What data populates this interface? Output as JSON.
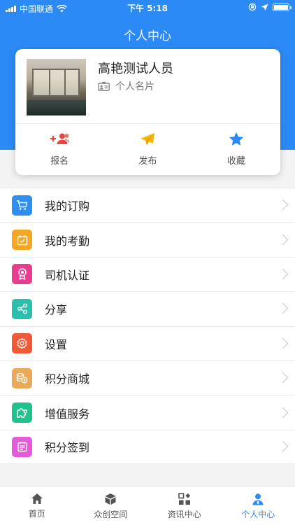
{
  "status_bar": {
    "carrier": "中国联通",
    "time": "下午 5:18"
  },
  "header": {
    "title": "个人中心"
  },
  "profile": {
    "name": "高艳测试人员",
    "card_label": "个人名片"
  },
  "actions": [
    {
      "label": "报名",
      "icon": "add-users-icon",
      "color": "#e8463d"
    },
    {
      "label": "发布",
      "icon": "paper-plane-icon",
      "color": "#f5b800"
    },
    {
      "label": "收藏",
      "icon": "star-icon",
      "color": "#2b8af5"
    }
  ],
  "menu": [
    {
      "label": "我的订购",
      "icon": "cart-icon",
      "color": "#2e8ff0"
    },
    {
      "label": "我的考勤",
      "icon": "calendar-icon",
      "color": "#f5a623"
    },
    {
      "label": "司机认证",
      "icon": "badge-icon",
      "color": "#ea3d8f"
    },
    {
      "label": "分享",
      "icon": "share-icon",
      "color": "#2cbfae"
    },
    {
      "label": "设置",
      "icon": "gear-icon",
      "color": "#f05a36"
    },
    {
      "label": "积分商城",
      "icon": "coins-icon",
      "color": "#e9aa5a"
    },
    {
      "label": "增值服务",
      "icon": "puzzle-icon",
      "color": "#1fc18f"
    },
    {
      "label": "积分签到",
      "icon": "checkin-icon",
      "color": "#e35bd8"
    }
  ],
  "tabs": [
    {
      "label": "首页",
      "icon": "home-icon",
      "active": false
    },
    {
      "label": "众创空间",
      "icon": "cube-icon",
      "active": false
    },
    {
      "label": "资讯中心",
      "icon": "grid-icon",
      "active": false
    },
    {
      "label": "个人中心",
      "icon": "user-icon",
      "active": true
    }
  ],
  "colors": {
    "brand": "#2b8af5",
    "background": "#f3f3f3"
  }
}
